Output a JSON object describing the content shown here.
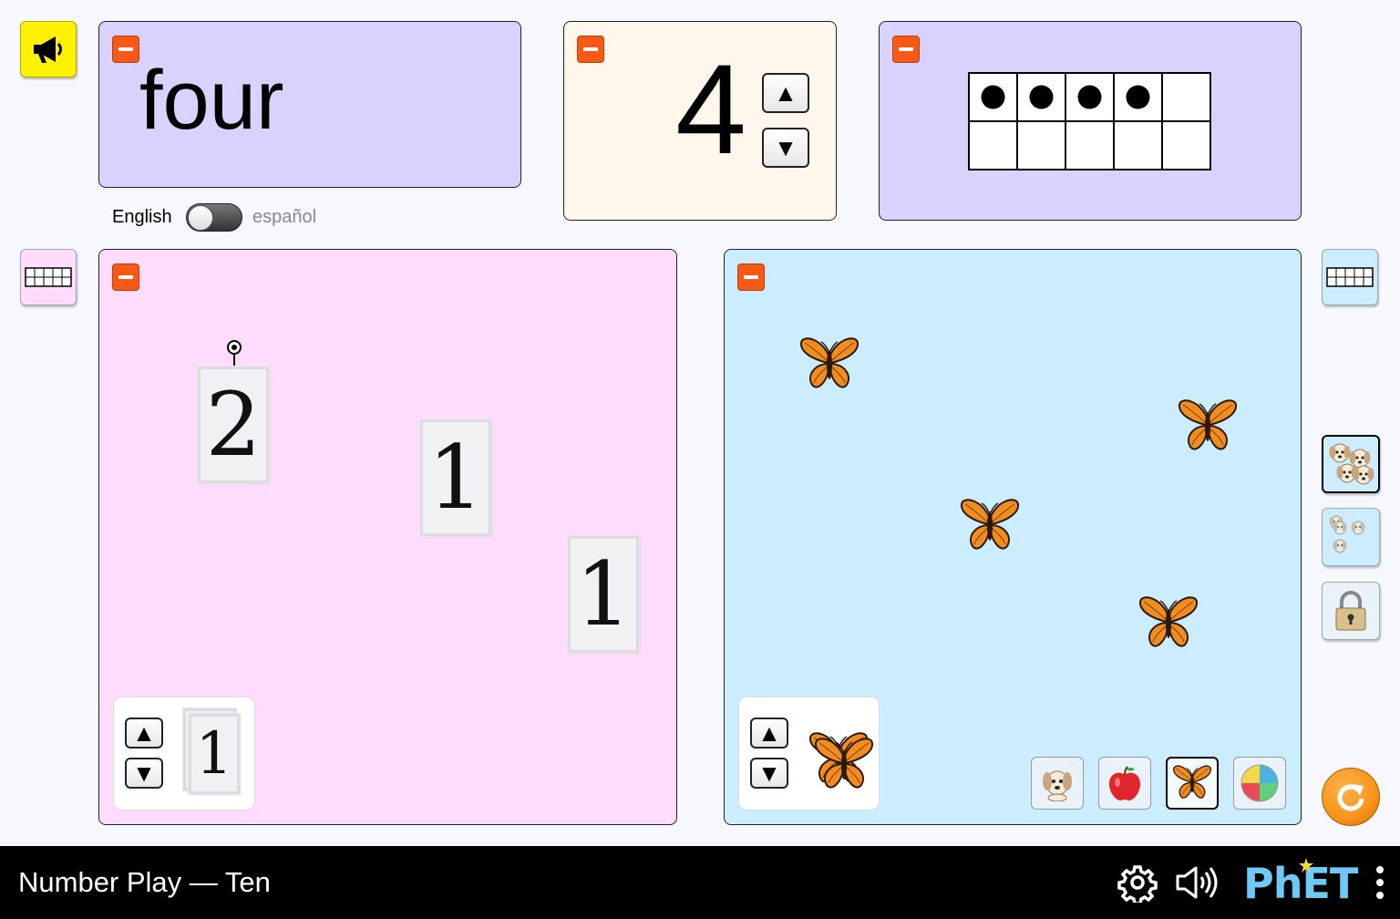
{
  "word_panel": {
    "word": "four"
  },
  "language": {
    "left_label": "English",
    "right_label": "español",
    "selected": "English"
  },
  "number_panel": {
    "value": "4",
    "up_symbol": "▲",
    "down_symbol": "▼"
  },
  "ten_frame": {
    "filled": 4,
    "total": 10
  },
  "cards_panel": {
    "cards": [
      "2",
      "1",
      "1"
    ],
    "creator": {
      "card_value": "1",
      "up_symbol": "▲",
      "down_symbol": "▼"
    }
  },
  "objects_panel": {
    "object_type": "butterfly",
    "count": 4,
    "creator": {
      "up_symbol": "▲",
      "down_symbol": "▼"
    },
    "object_buttons": [
      "dog",
      "apple",
      "butterfly",
      "ball"
    ],
    "selected_object": "butterfly"
  },
  "side_controls": [
    "organize-dogs-button",
    "group-dogs-button",
    "lock-button"
  ],
  "colors": {
    "word_panel_bg": "#d7d2ff",
    "number_panel_bg": "#fff7ec",
    "cards_panel_bg": "#ffdcfe",
    "objects_panel_bg": "#ccecff",
    "minus_button": "#f85a15",
    "speaker_button": "#fff200",
    "reset_button": "#f7941d"
  },
  "footer": {
    "title": "Number Play — Ten",
    "brand": "PhET"
  }
}
